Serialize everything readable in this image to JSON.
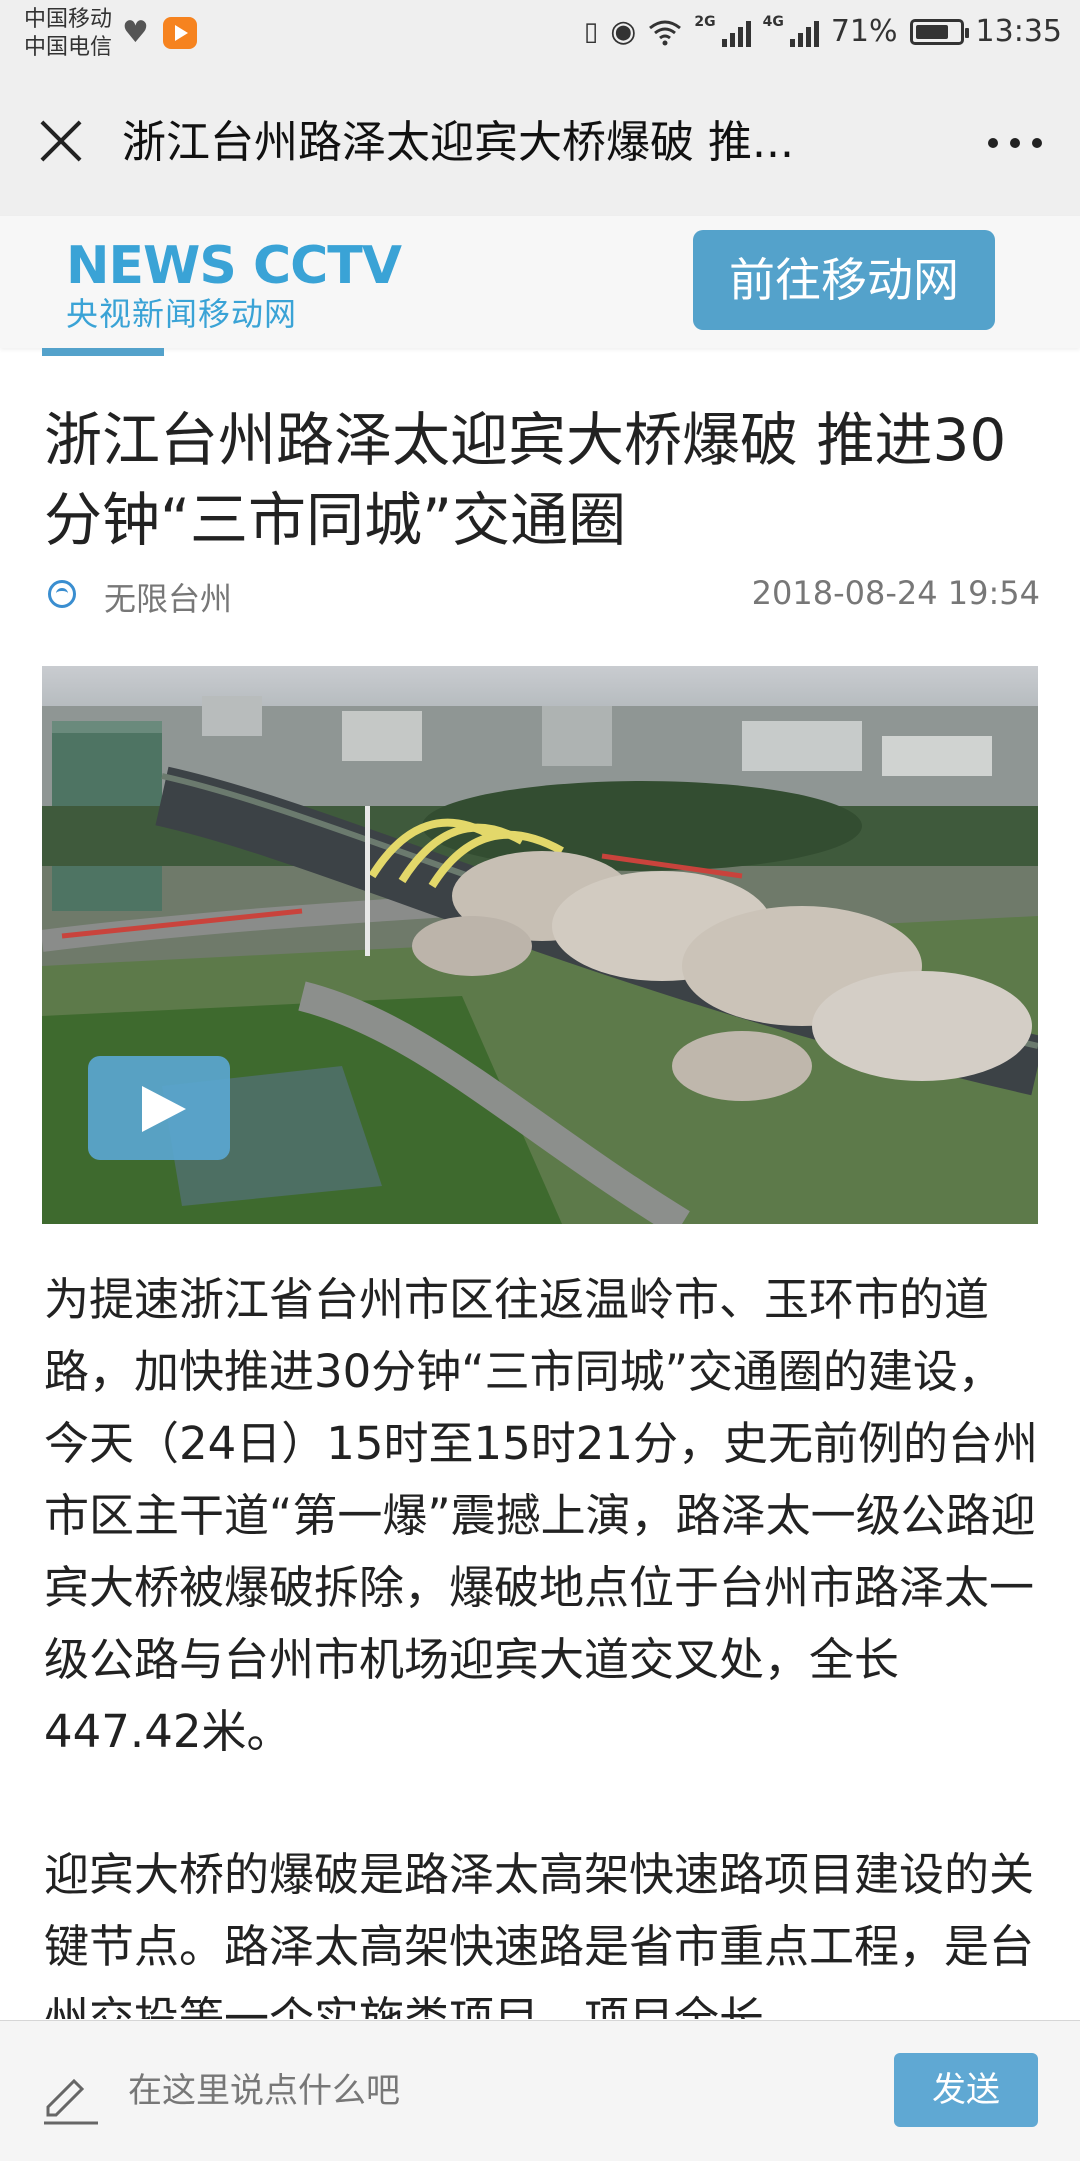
{
  "status_bar": {
    "carrier_1": "中国移动",
    "carrier_2": "中国电信",
    "network_1": "2G",
    "network_2": "4G",
    "battery": "71%",
    "time": "13:35",
    "icons": [
      "heartbeat-icon",
      "video-app-icon",
      "vibrate-icon",
      "eye-icon",
      "wifi-icon",
      "signal-icon",
      "battery-icon"
    ]
  },
  "nav": {
    "title": "浙江台州路泽太迎宾大桥爆破 推...",
    "close_icon": "close-icon",
    "more_icon": "more-icon"
  },
  "banner": {
    "logo_top": "NEWS CCTV",
    "logo_bottom": "央视新闻移动网",
    "cta": "前往移动网",
    "accent": "#54a2cb"
  },
  "article": {
    "headline": "浙江台州路泽太迎宾大桥爆破 推进30分钟“三市同城”交通圈",
    "source": "无限台州",
    "date": "2018-08-24 19:54",
    "paragraphs": [
      "为提速浙江省台州市区往返温岭市、玉环市的道路，加快推进30分钟“三市同城”交通圈的建设，今天（24日）15时至15时21分，史无前例的台州市区主干道“第一爆”震撼上演，路泽太一级公路迎宾大桥被爆破拆除，爆破地点位于台州市路泽太一级公路与台州市机场迎宾大道交叉处，全长447.42米。",
      "迎宾大桥的爆破是路泽太高架快速路项目建设的关键节点。路泽太高架快速路是省市重点工程，是台州交投等一个实施类项目，项目全长"
    ]
  },
  "comment": {
    "placeholder": "在这里说点什么吧",
    "send": "发送"
  }
}
